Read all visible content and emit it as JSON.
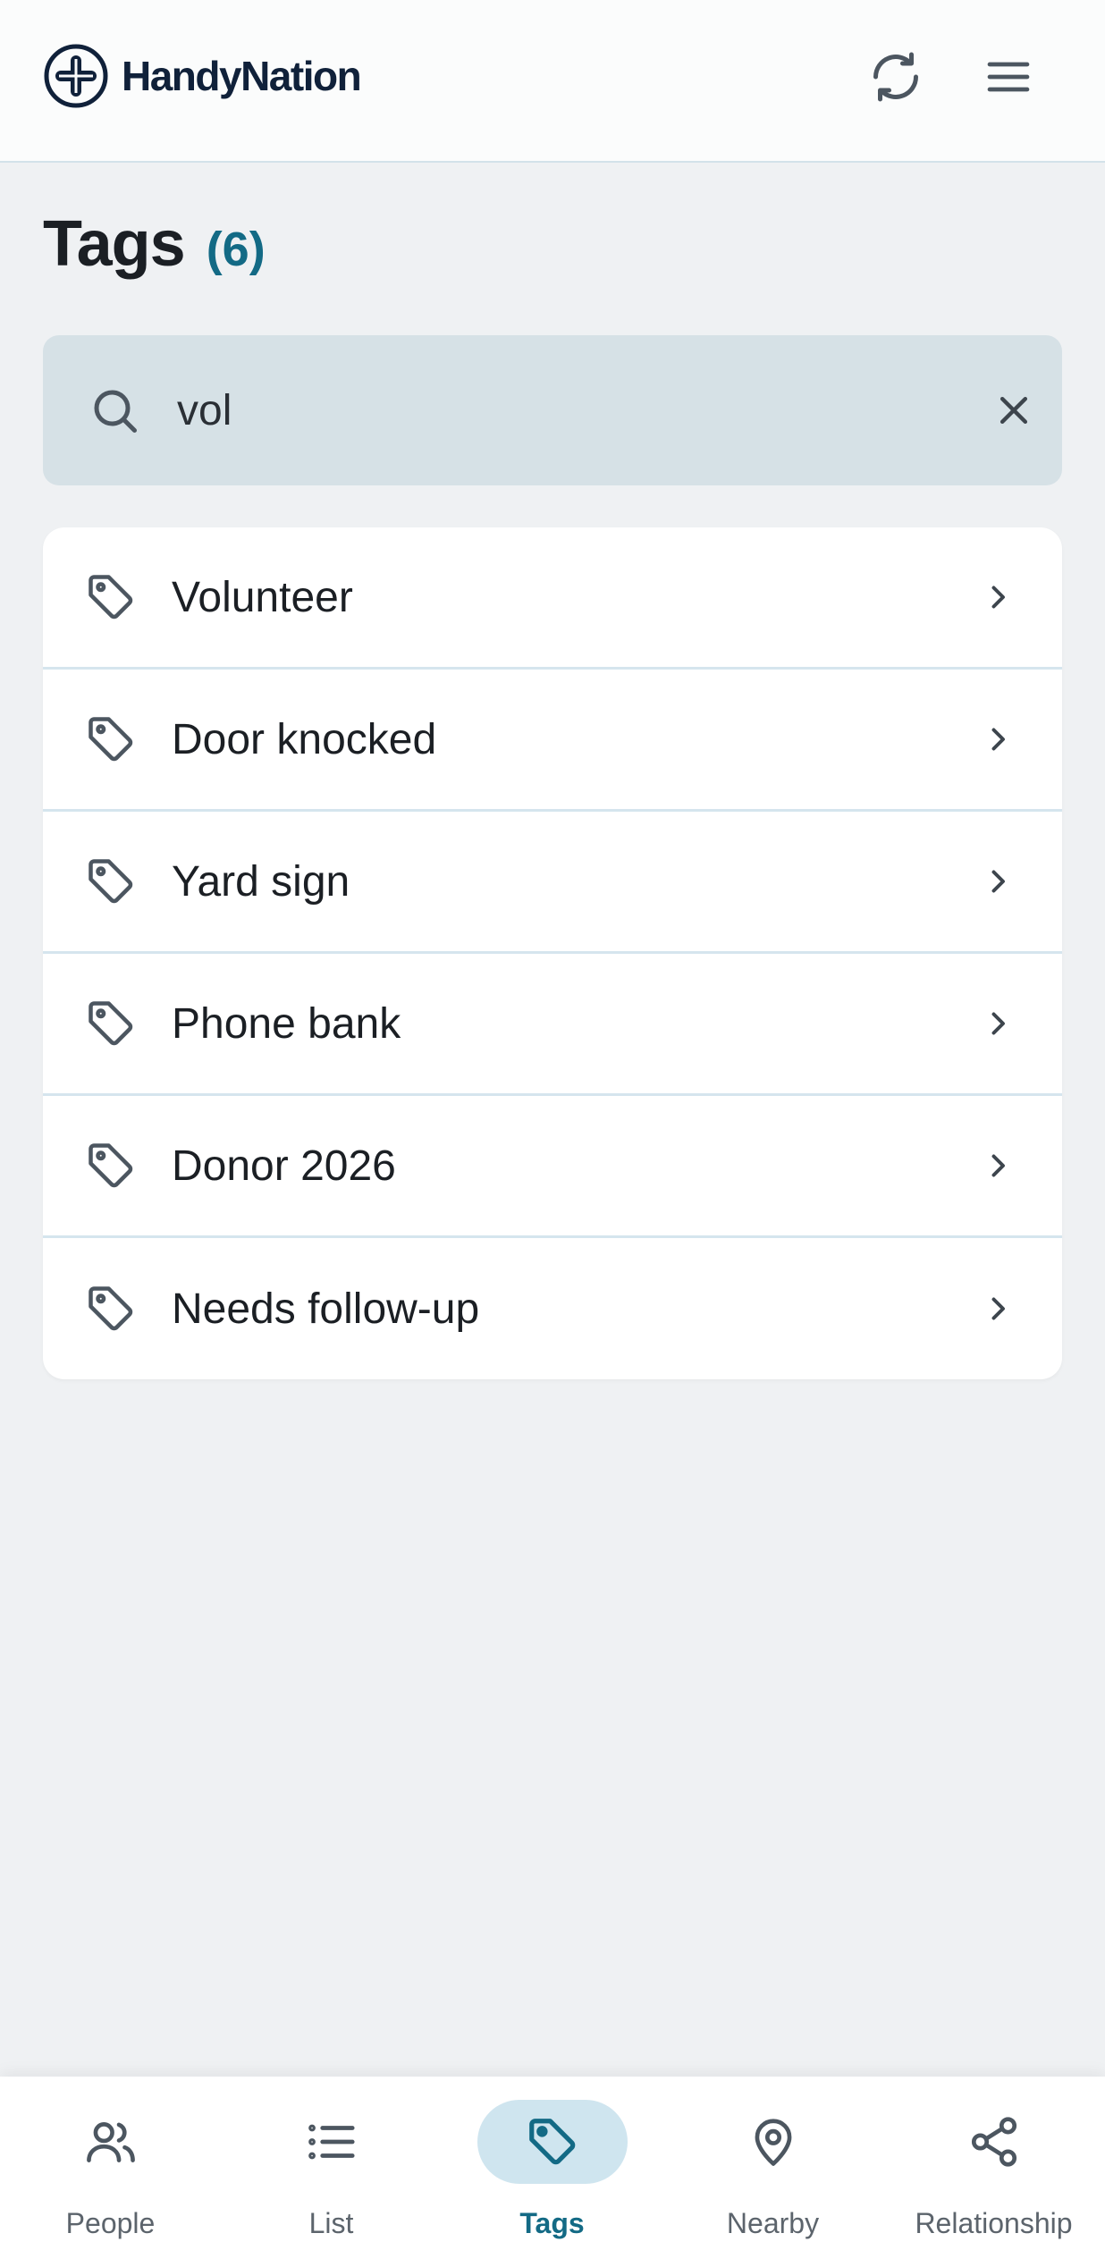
{
  "header": {
    "brand_name": "HandyNation",
    "refresh_icon": "refresh-icon",
    "menu_icon": "hamburger-menu-icon"
  },
  "page": {
    "title": "Tags",
    "count": "(6)"
  },
  "search": {
    "value": "vol",
    "search_icon": "search-icon",
    "clear_icon": "close-icon"
  },
  "tags": [
    {
      "label": "Volunteer"
    },
    {
      "label": "Door knocked"
    },
    {
      "label": "Yard sign"
    },
    {
      "label": "Phone bank"
    },
    {
      "label": "Donor 2026"
    },
    {
      "label": "Needs follow-up"
    }
  ],
  "nav": {
    "items": [
      {
        "label": "People",
        "icon": "people-icon",
        "active": false
      },
      {
        "label": "List",
        "icon": "list-icon",
        "active": false
      },
      {
        "label": "Tags",
        "icon": "tag-icon",
        "active": true
      },
      {
        "label": "Nearby",
        "icon": "map-pin-icon",
        "active": false
      },
      {
        "label": "Relationship",
        "icon": "share-icon",
        "active": false
      }
    ]
  },
  "colors": {
    "accent": "#136a85",
    "brand": "#10213a",
    "background": "#eff1f3",
    "search_bg": "#d6e1e6",
    "active_pill": "#cfe5ef"
  }
}
